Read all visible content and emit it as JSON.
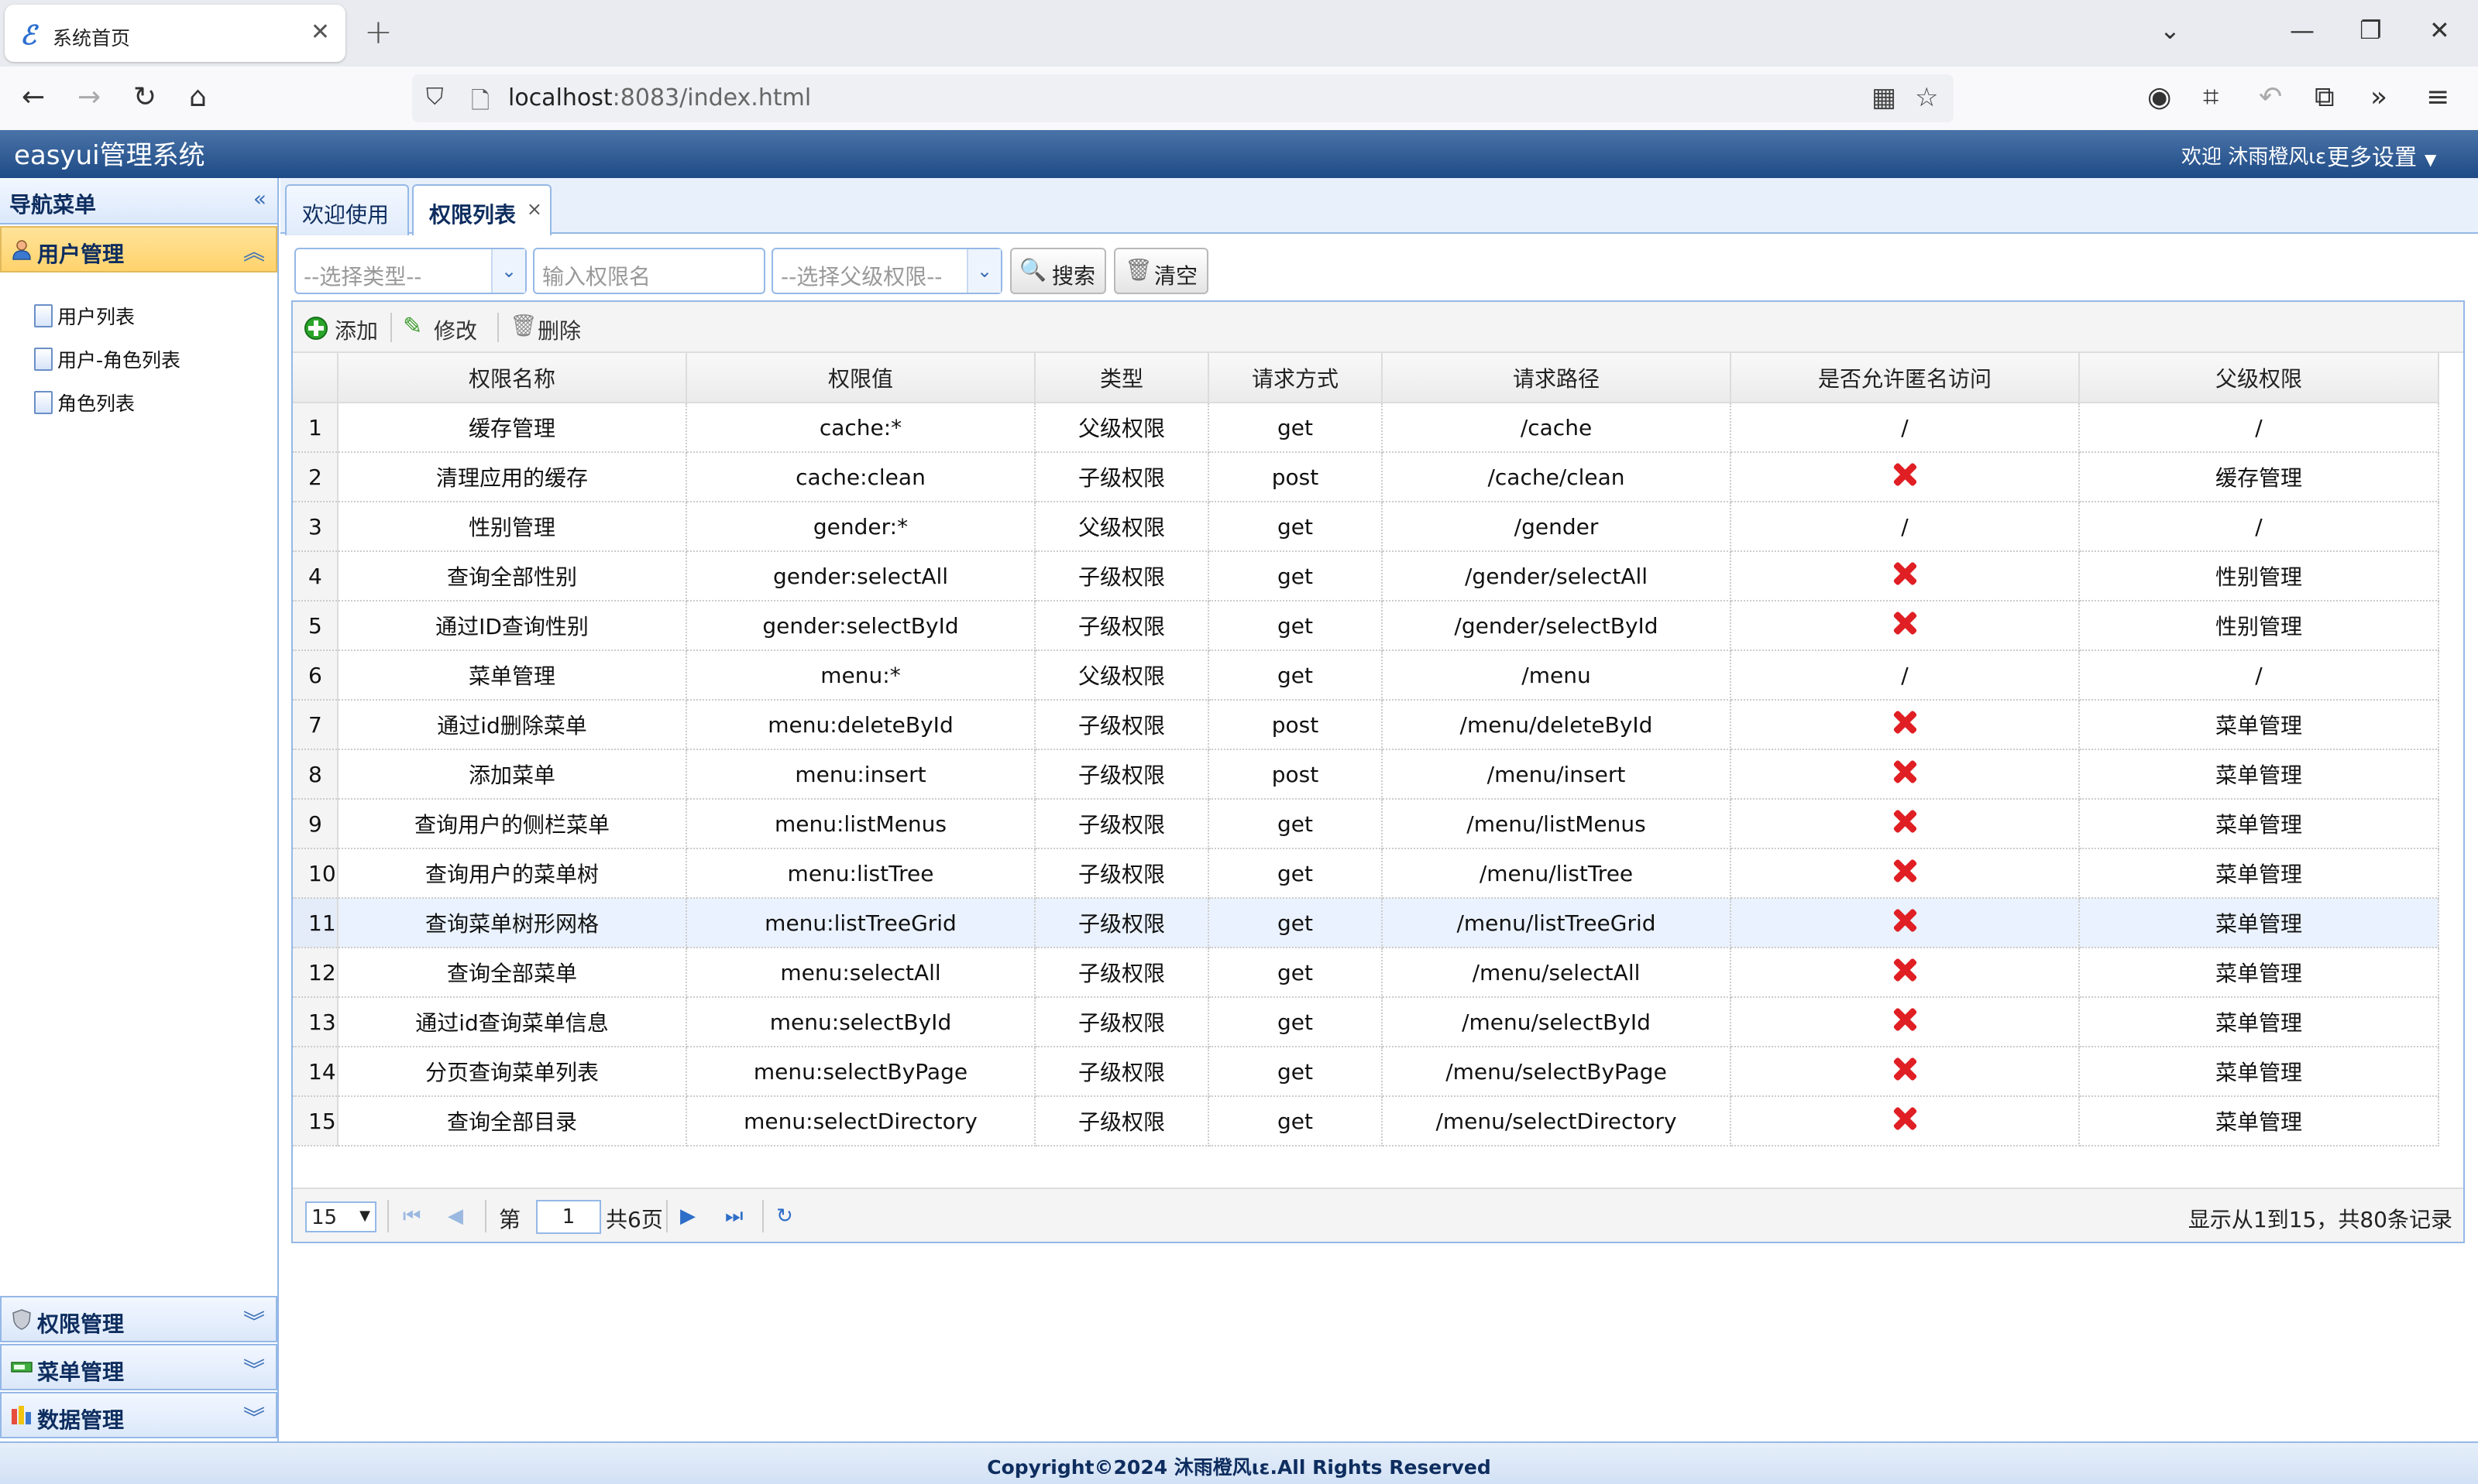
{
  "browser": {
    "tab_title": "系统首页",
    "url_host": "localhost",
    "url_rest": ":8083/index.html"
  },
  "app": {
    "title": "easyui管理系统",
    "welcome": "欢迎 沐雨橙风ιε",
    "more_settings": "更多设置"
  },
  "nav": {
    "title": "导航菜单",
    "user_group": "用户管理",
    "user_items": [
      "用户列表",
      "用户-角色列表",
      "角色列表"
    ],
    "permission_group": "权限管理",
    "menu_group": "菜单管理",
    "data_group": "数据管理"
  },
  "tabs": [
    {
      "label": "欢迎使用",
      "active": false
    },
    {
      "label": "权限列表",
      "active": true
    }
  ],
  "search": {
    "type_placeholder": "--选择类型--",
    "name_placeholder": "输入权限名",
    "parent_placeholder": "--选择父级权限--",
    "search_label": "搜索",
    "clear_label": "清空"
  },
  "toolbar": {
    "add_label": "添加",
    "edit_label": "修改",
    "delete_label": "删除"
  },
  "table": {
    "columns": [
      "权限名称",
      "权限值",
      "类型",
      "请求方式",
      "请求路径",
      "是否允许匿名访问",
      "父级权限"
    ],
    "highlighted_row": 11,
    "rows": [
      {
        "n": "1",
        "name": "缓存管理",
        "value": "cache:*",
        "type": "父级权限",
        "method": "get",
        "path": "/cache",
        "anon": "/",
        "parent": "/"
      },
      {
        "n": "2",
        "name": "清理应用的缓存",
        "value": "cache:clean",
        "type": "子级权限",
        "method": "post",
        "path": "/cache/clean",
        "anon": "x",
        "parent": "缓存管理"
      },
      {
        "n": "3",
        "name": "性别管理",
        "value": "gender:*",
        "type": "父级权限",
        "method": "get",
        "path": "/gender",
        "anon": "/",
        "parent": "/"
      },
      {
        "n": "4",
        "name": "查询全部性别",
        "value": "gender:selectAll",
        "type": "子级权限",
        "method": "get",
        "path": "/gender/selectAll",
        "anon": "x",
        "parent": "性别管理"
      },
      {
        "n": "5",
        "name": "通过ID查询性别",
        "value": "gender:selectById",
        "type": "子级权限",
        "method": "get",
        "path": "/gender/selectById",
        "anon": "x",
        "parent": "性别管理"
      },
      {
        "n": "6",
        "name": "菜单管理",
        "value": "menu:*",
        "type": "父级权限",
        "method": "get",
        "path": "/menu",
        "anon": "/",
        "parent": "/"
      },
      {
        "n": "7",
        "name": "通过id删除菜单",
        "value": "menu:deleteById",
        "type": "子级权限",
        "method": "post",
        "path": "/menu/deleteById",
        "anon": "x",
        "parent": "菜单管理"
      },
      {
        "n": "8",
        "name": "添加菜单",
        "value": "menu:insert",
        "type": "子级权限",
        "method": "post",
        "path": "/menu/insert",
        "anon": "x",
        "parent": "菜单管理"
      },
      {
        "n": "9",
        "name": "查询用户的侧栏菜单",
        "value": "menu:listMenus",
        "type": "子级权限",
        "method": "get",
        "path": "/menu/listMenus",
        "anon": "x",
        "parent": "菜单管理"
      },
      {
        "n": "10",
        "name": "查询用户的菜单树",
        "value": "menu:listTree",
        "type": "子级权限",
        "method": "get",
        "path": "/menu/listTree",
        "anon": "x",
        "parent": "菜单管理"
      },
      {
        "n": "11",
        "name": "查询菜单树形网格",
        "value": "menu:listTreeGrid",
        "type": "子级权限",
        "method": "get",
        "path": "/menu/listTreeGrid",
        "anon": "x",
        "parent": "菜单管理"
      },
      {
        "n": "12",
        "name": "查询全部菜单",
        "value": "menu:selectAll",
        "type": "子级权限",
        "method": "get",
        "path": "/menu/selectAll",
        "anon": "x",
        "parent": "菜单管理"
      },
      {
        "n": "13",
        "name": "通过id查询菜单信息",
        "value": "menu:selectById",
        "type": "子级权限",
        "method": "get",
        "path": "/menu/selectById",
        "anon": "x",
        "parent": "菜单管理"
      },
      {
        "n": "14",
        "name": "分页查询菜单列表",
        "value": "menu:selectByPage",
        "type": "子级权限",
        "method": "get",
        "path": "/menu/selectByPage",
        "anon": "x",
        "parent": "菜单管理"
      },
      {
        "n": "15",
        "name": "查询全部目录",
        "value": "menu:selectDirectory",
        "type": "子级权限",
        "method": "get",
        "path": "/menu/selectDirectory",
        "anon": "x",
        "parent": "菜单管理"
      }
    ]
  },
  "pager": {
    "page_size": "15",
    "page_prefix": "第",
    "current_page": "1",
    "page_total": "共6页",
    "summary": "显示从1到15，共80条记录"
  },
  "footer": {
    "copyright": "Copyright©2024 沐雨橙风ιε.All Rights Reserved"
  },
  "colors": {
    "header_blue": "#1e4a86",
    "panel_border": "#95b8e7",
    "active_group": "#ffd36c",
    "deny_red": "#e01f24"
  }
}
